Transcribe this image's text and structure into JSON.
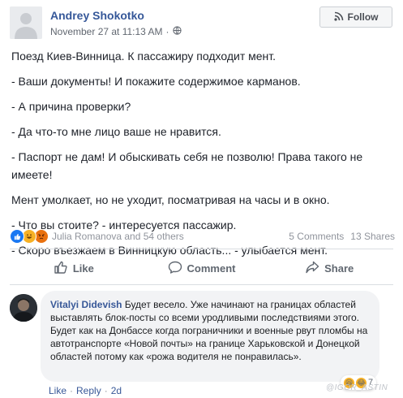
{
  "post": {
    "author": "Andrey Shokotko",
    "timestamp": "November 27 at 11:13 AM",
    "separator": "·",
    "privacy_icon": "globe-icon",
    "follow_label": "Follow",
    "paragraphs": [
      "Поезд Киев-Винница. К пассажиру подходит мент.",
      "- Ваши документы! И покажите содержимое карманов.",
      "- А причина проверки?",
      "- Да что-то мне лицо ваше не нравится.",
      "- Паспорт не дам! И обыскивать себя не позволю! Права такого не имеете!",
      "Мент умолкает, но не уходит, посматривая на часы и в окно.",
      "- Что вы стоите? - интересуется пассажир.",
      "- Скоро въезжаем в Винницкую область... - улыбается мент."
    ],
    "reactions": {
      "icons": [
        "like-icon",
        "haha-icon",
        "angry-icon"
      ],
      "names": "Julia Romanova and 54 others",
      "comments": "5 Comments",
      "shares": "13 Shares"
    },
    "actions": {
      "like": "Like",
      "comment": "Comment",
      "share": "Share"
    }
  },
  "comment": {
    "author": "Vitalyi Didevish",
    "text": "Будет весело. Уже начинают на границах областей выставлять блок-посты со всеми уродливыми последствиями этого. Будет как на Донбассе когда пограничники и военные рвут пломбы на автотранспорте «Новой почты» на границе Харьковской и Донецкой областей потому как «рожа водителя не понравилась».",
    "reaction_count": "7",
    "like": "Like",
    "reply": "Reply",
    "dot": "·",
    "age": "2d"
  },
  "watermark": "@IGOR_ASTIN",
  "colors": {
    "link_blue": "#365899",
    "like_blue": "#1877f2",
    "haha_yellow": "#f7b125",
    "angry_orange": "#e9710f"
  }
}
